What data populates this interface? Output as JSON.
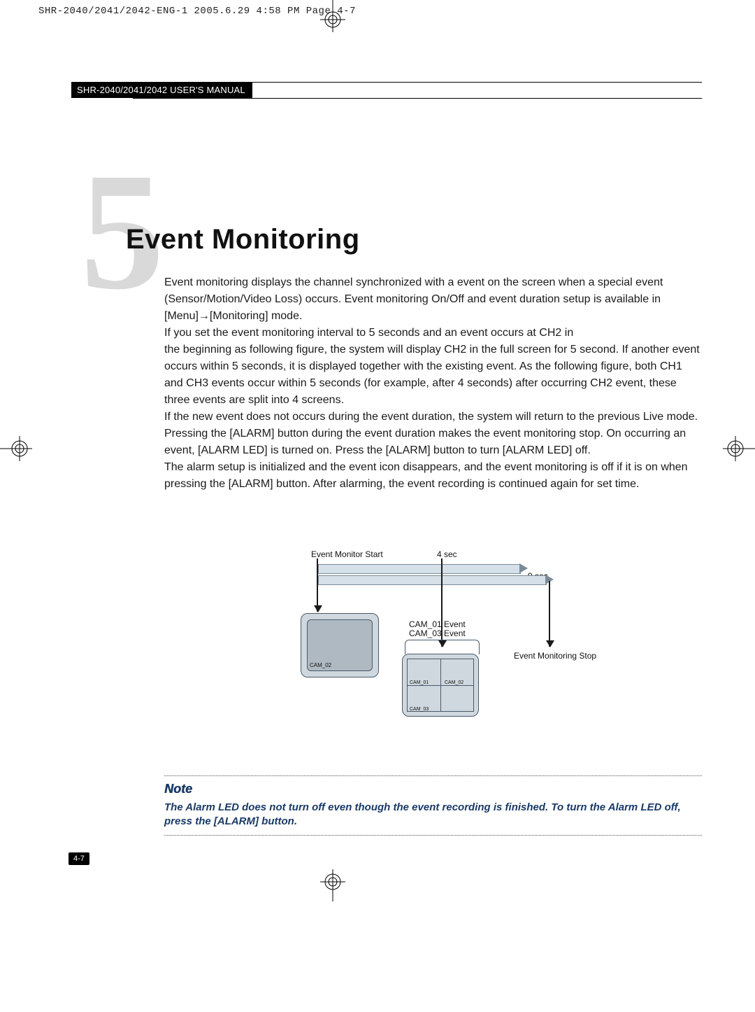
{
  "crop_marks_header": "SHR-2040/2041/2042-ENG-1  2005.6.29  4:58 PM  Page 4-7",
  "manual_header": "SHR-2040/2041/2042 USER'S MANUAL",
  "chapter_number": "5",
  "title": "Event Monitoring",
  "paragraphs": {
    "p1": "Event monitoring displays the channel synchronized with a event on the screen when a special event (Sensor/Motion/Video Loss)  occurs. Event monitoring On/Off and event duration setup is available in [Menu]→[Monitoring] mode.",
    "p2": "If you set the event monitoring interval to 5 seconds and an event occurs at CH2 in",
    "p3": "the beginning as following figure, the system will display CH2 in the full screen for 5 second. If  another event occurs within 5 seconds, it is displayed together with the existing event. As the following figure, both CH1 and CH3 events occur within 5 seconds (for example, after 4 seconds) after occurring CH2 event, these three events are split into 4 screens.",
    "p4": "If the new event does not occurs during the event duration, the system will return to the previous Live mode. Pressing the [ALARM] button during the event duration makes  the event monitoring stop.  On occurring an event, [ALARM LED] is turned on. Press the [ALARM] button to turn [ALARM LED] off.",
    "p5": "The alarm setup is initialized and the event icon disappears, and the event monitoring is off if it is on when pressing the [ALARM] button. After alarming, the event recording is continued again for set time."
  },
  "diagram": {
    "start_label": "Event Monitor Start",
    "four_sec": "4 sec",
    "nine_sec": "9 sec",
    "cam01_event": "CAM_01 Event",
    "cam03_event": "CAM_03 Event",
    "stop_label": "Event Monitoring Stop",
    "single_cam": "CAM_02",
    "grid": {
      "tl": "CAM_01",
      "tr": "CAM_02",
      "bl": "CAM_03",
      "br": ""
    }
  },
  "note": {
    "heading": "Note",
    "body": "The Alarm LED does not turn off even though the event recording is finished. To turn the Alarm LED off, press the [ALARM] button."
  },
  "page_number": "4-7"
}
